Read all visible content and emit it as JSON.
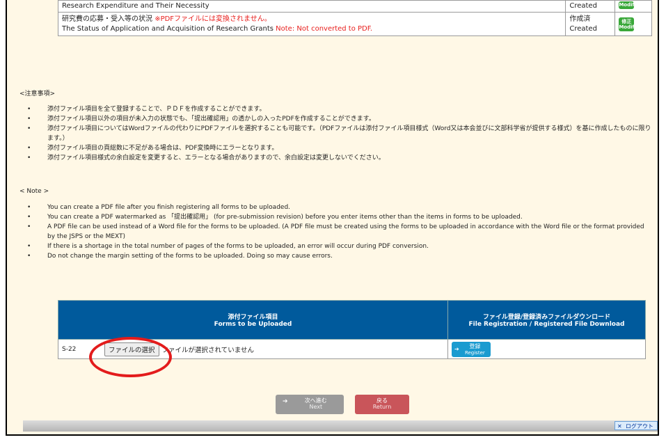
{
  "top_rows": [
    {
      "title_en": "Research Expenditure and Their Necessity",
      "status_en": "Created",
      "button_label_en": "Modify"
    },
    {
      "title_ja": "研究費の応募・受入等の状況",
      "note_ja": "※PDFファイルには変換されません。",
      "title_en": "The Status of Application and Acquisition of Research Grants",
      "note_en": "Note: Not converted to PDF.",
      "status_ja": "作成済",
      "status_en": "Created",
      "button_label_ja": "修正",
      "button_label_en": "Modify"
    }
  ],
  "notes_ja": {
    "heading": "<注意事項>",
    "items": [
      "添付ファイル項目を全て登録することで、ＰＤＦを作成することができます。",
      "添付ファイル項目以外の項目が未入力の状態でも、「提出確認用」の透かしの入ったPDFを作成することができます。",
      "添付ファイル項目についてはWordファイルの代わりにPDFファイルを選択することも可能です。（PDFファイルは添付ファイル項目様式（Word又は本会並びに文部科学省が提供する様式）を基に作成したものに限ります。）",
      "添付ファイル項目の頁総数に不足がある場合は、PDF変換時にエラーとなります。",
      "添付ファイル項目様式の余白設定を変更すると、エラーとなる場合がありますので、余白設定は変更しないでください。"
    ]
  },
  "notes_en": {
    "heading": "< Note >",
    "items": [
      "You can create a PDF file after you finish registering all forms to be uploaded.",
      "You can create a PDF watermarked as 「提出確認用」 (for pre-submission revision) before you enter items other than the items in forms to be uploaded.",
      "A PDF file can be used instead of a Word file for the forms to be uploaded. (A PDF file must be created using the forms to be uploaded in accordance with the Word file or the format provided by the JSPS or the MEXT)",
      "If there is a shortage in the total number of pages of the forms to be uploaded, an error will occur during PDF conversion.",
      "Do not change the margin setting of the forms to be uploaded. Doing so may cause errors."
    ]
  },
  "upload_table": {
    "col1_ja": "添付ファイル項目",
    "col1_en": "Forms to be Uploaded",
    "col2_ja": "ファイル登録/登録済みファイルダウンロード",
    "col2_en": "File Registration / Registered File Download",
    "row": {
      "code": "S-22",
      "choose_file_label": "ファイルの選択",
      "no_file_text": "ファイルが選択されていません",
      "register_ja": "登録",
      "register_en": "Register"
    }
  },
  "nav": {
    "next_ja": "次へ進む",
    "next_en": "Next",
    "return_ja": "戻る",
    "return_en": "Return",
    "logout_label": "ログアウト"
  },
  "colors": {
    "frame_bg": "#fff8e6",
    "table_header": "#005a9c",
    "modify_button": "#3aa83a",
    "register_button": "#1a9bd0",
    "return_button": "#c9555a",
    "next_button_disabled": "#9a9a9a",
    "highlight_circle": "#e31c1c",
    "note_red": "#e8201e"
  }
}
